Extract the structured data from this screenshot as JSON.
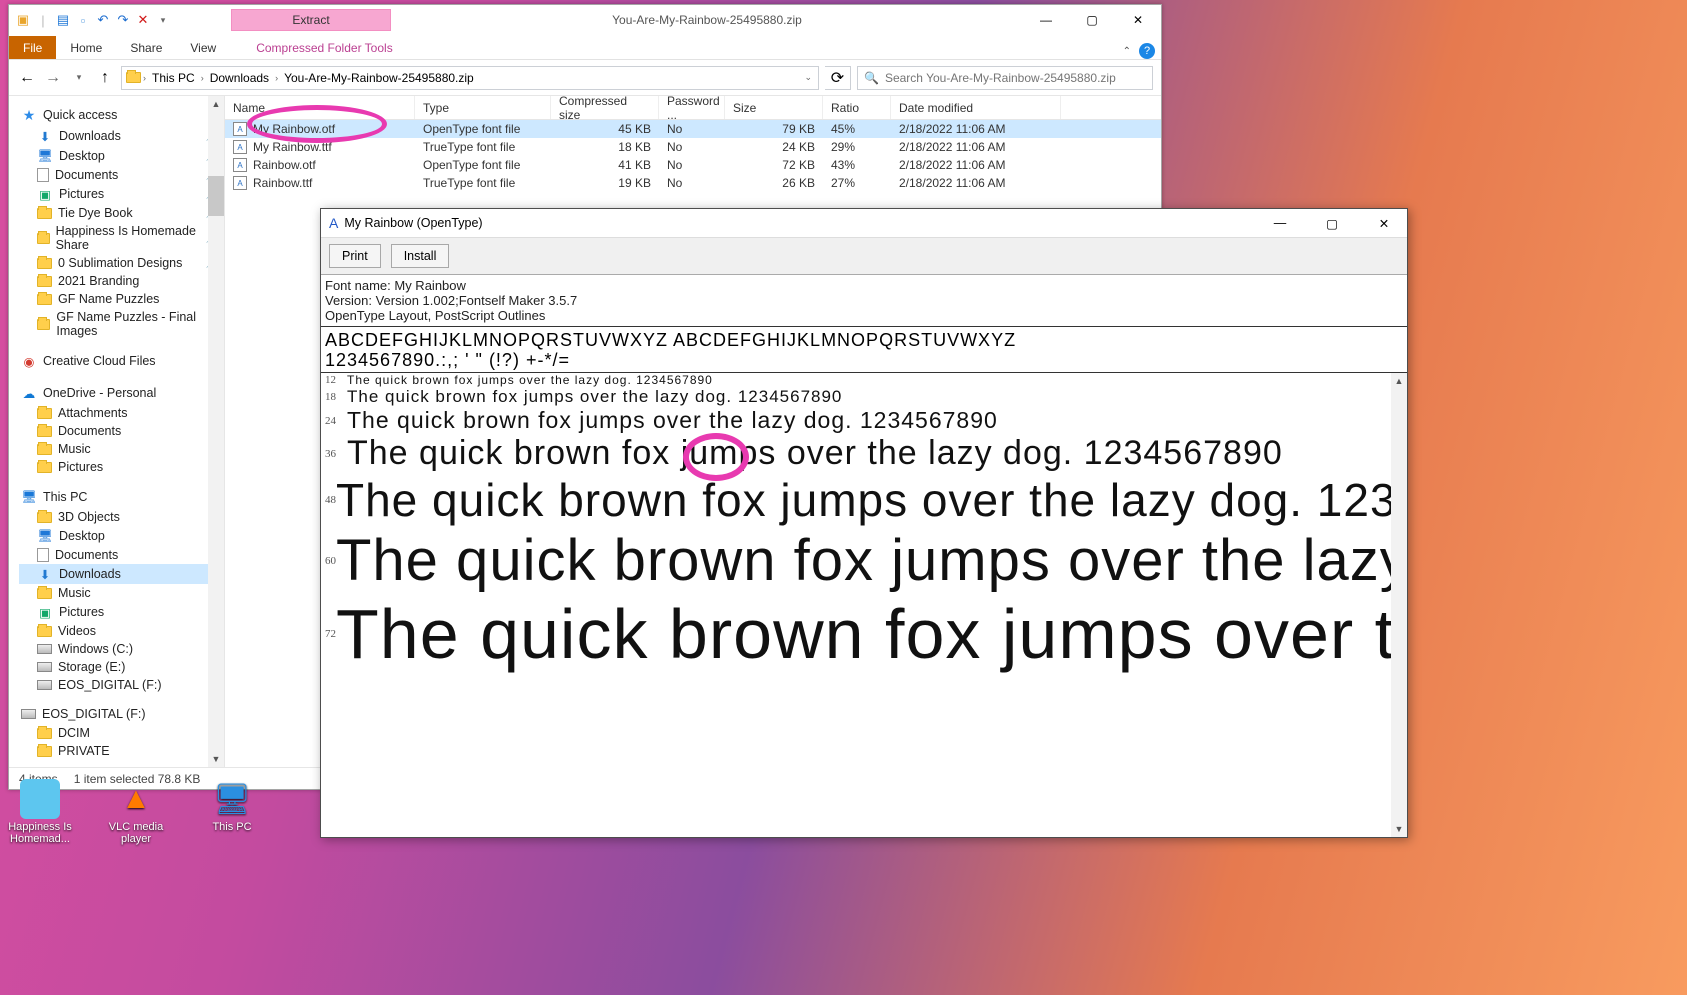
{
  "explorer": {
    "tool_tab_label": "Extract",
    "title": "You-Are-My-Rainbow-25495880.zip",
    "ribbon": {
      "file": "File",
      "home": "Home",
      "share": "Share",
      "view": "View",
      "tool": "Compressed Folder Tools"
    },
    "breadcrumb": [
      "This PC",
      "Downloads",
      "You-Are-My-Rainbow-25495880.zip"
    ],
    "search_placeholder": "Search You-Are-My-Rainbow-25495880.zip",
    "sidebar": {
      "quick": {
        "label": "Quick access",
        "items": [
          {
            "label": "Downloads",
            "pin": true,
            "icon": "down"
          },
          {
            "label": "Desktop",
            "pin": true,
            "icon": "desk"
          },
          {
            "label": "Documents",
            "pin": true,
            "icon": "doc"
          },
          {
            "label": "Pictures",
            "pin": true,
            "icon": "pic"
          },
          {
            "label": "Tie Dye Book",
            "pin": true,
            "icon": "folder"
          },
          {
            "label": "Happiness Is Homemade Share",
            "pin": true,
            "icon": "folder"
          },
          {
            "label": "0 Sublimation Designs",
            "pin": true,
            "icon": "folder"
          },
          {
            "label": "2021 Branding",
            "pin": false,
            "icon": "folder"
          },
          {
            "label": "GF Name Puzzles",
            "pin": false,
            "icon": "folder"
          },
          {
            "label": "GF Name Puzzles - Final Images",
            "pin": false,
            "icon": "folder"
          }
        ]
      },
      "cc": {
        "label": "Creative Cloud Files"
      },
      "onedrive": {
        "label": "OneDrive - Personal",
        "items": [
          {
            "label": "Attachments"
          },
          {
            "label": "Documents"
          },
          {
            "label": "Music"
          },
          {
            "label": "Pictures"
          }
        ]
      },
      "thispc": {
        "label": "This PC",
        "items": [
          {
            "label": "3D Objects",
            "icon": "folder"
          },
          {
            "label": "Desktop",
            "icon": "desk"
          },
          {
            "label": "Documents",
            "icon": "doc"
          },
          {
            "label": "Downloads",
            "icon": "down",
            "sel": true
          },
          {
            "label": "Music",
            "icon": "folder"
          },
          {
            "label": "Pictures",
            "icon": "pic"
          },
          {
            "label": "Videos",
            "icon": "folder"
          },
          {
            "label": "Windows (C:)",
            "icon": "drive"
          },
          {
            "label": "Storage (E:)",
            "icon": "drive"
          },
          {
            "label": "EOS_DIGITAL (F:)",
            "icon": "drive"
          }
        ]
      },
      "eos": {
        "label": "EOS_DIGITAL (F:)",
        "items": [
          {
            "label": "DCIM"
          },
          {
            "label": "PRIVATE"
          }
        ]
      }
    },
    "columns": {
      "name": "Name",
      "type": "Type",
      "compressed": "Compressed size",
      "password": "Password ...",
      "size": "Size",
      "ratio": "Ratio",
      "date": "Date modified"
    },
    "files": [
      {
        "name": "My Rainbow.otf",
        "type": "OpenType font file",
        "compressed": "45 KB",
        "password": "No",
        "size": "79 KB",
        "ratio": "45%",
        "date": "2/18/2022 11:06 AM",
        "sel": true
      },
      {
        "name": "My Rainbow.ttf",
        "type": "TrueType font file",
        "compressed": "18 KB",
        "password": "No",
        "size": "24 KB",
        "ratio": "29%",
        "date": "2/18/2022 11:06 AM"
      },
      {
        "name": "Rainbow.otf",
        "type": "OpenType font file",
        "compressed": "41 KB",
        "password": "No",
        "size": "72 KB",
        "ratio": "43%",
        "date": "2/18/2022 11:06 AM"
      },
      {
        "name": "Rainbow.ttf",
        "type": "TrueType font file",
        "compressed": "19 KB",
        "password": "No",
        "size": "26 KB",
        "ratio": "27%",
        "date": "2/18/2022 11:06 AM"
      }
    ],
    "status": {
      "items": "4 items",
      "selected": "1 item selected  78.8 KB"
    }
  },
  "fontwin": {
    "title": "My Rainbow (OpenType)",
    "print": "Print",
    "install": "Install",
    "meta": {
      "name": "Font name: My Rainbow",
      "version": "Version: Version 1.002;Fontself Maker 3.5.7",
      "layout": "OpenType Layout, PostScript Outlines"
    },
    "glyphs_upper": "ABCDEFGHIJKLMNOPQRSTUVWXYZ  ABCDEFGHIJKLMNOPQRSTUVWXYZ",
    "glyphs_lower": "1234567890.:,; ' \" (!?) +-*/=",
    "sample_text": "The quick brown fox jumps over the lazy dog. 1234567890",
    "sizes": [
      "12",
      "18",
      "24",
      "36",
      "48",
      "60",
      "72"
    ]
  },
  "desktop": [
    {
      "label": "Happiness Is Homemad..."
    },
    {
      "label": "VLC media player"
    },
    {
      "label": "This PC"
    }
  ]
}
